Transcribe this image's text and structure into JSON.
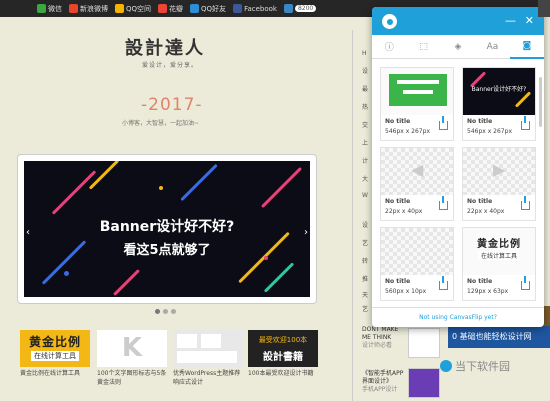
{
  "share_bar": {
    "items": [
      {
        "label": "微信",
        "color": "#3ca73f"
      },
      {
        "label": "新浪微博",
        "color": "#e8452b"
      },
      {
        "label": "QQ空间",
        "color": "#f5b400"
      },
      {
        "label": "花瓣",
        "color": "#e43"
      },
      {
        "label": "QQ好友",
        "color": "#2d8ed8"
      },
      {
        "label": "Facebook",
        "color": "#3b5998"
      }
    ],
    "count": "8200"
  },
  "site": {
    "logo": "設計達人",
    "tagline": "爱设计，爱分享。",
    "year": "-2017-",
    "year_sub": "小博客，大智慧，一起加油~"
  },
  "banner": {
    "line1": "Banner设计好不好?",
    "line2": "看这5点就够了",
    "prev": "‹",
    "next": "›"
  },
  "thumbs": [
    {
      "caption": "黄金比例在线计算工具",
      "t1": "黄金比例",
      "t2": "在线计算工具"
    },
    {
      "caption": "100个文字图形标志与5条黄金法则",
      "t1": "K"
    },
    {
      "caption": "优秀WordPress主题推荐 响应式设计"
    },
    {
      "caption": "100本最受欢迎设计书籍",
      "t1": "最受欢迎100本",
      "t2": "設計書籍"
    }
  ],
  "right_col": {
    "chars": [
      "H",
      "设",
      "最",
      "热",
      "交",
      "上",
      "计",
      "大",
      "W",
      "设",
      "艺",
      "转",
      "推",
      "天",
      "艺"
    ],
    "items": [
      {
        "title": "DONT MAKE ME THINK",
        "sub": "设计师必看"
      },
      {
        "title": "《智能手机APP界面设计》",
        "sub": "手机APP设计"
      }
    ],
    "ad_text": "0 基础也能轻松设计网",
    "watermark": "当下软件园"
  },
  "panel": {
    "tabs": [
      {
        "icon": "info-icon",
        "label": "ⓘ"
      },
      {
        "icon": "cursor-icon",
        "label": "⬚"
      },
      {
        "icon": "drop-icon",
        "label": "◈"
      },
      {
        "icon": "font-icon",
        "label": "Aa"
      },
      {
        "icon": "camera-icon",
        "label": "◙"
      }
    ],
    "cards": [
      {
        "title": "No title",
        "size": "546px x 267px",
        "kind": "green"
      },
      {
        "title": "No title",
        "size": "546px x 267px",
        "kind": "banner"
      },
      {
        "title": "No title",
        "size": "22px x 40px",
        "kind": "arrow-left"
      },
      {
        "title": "No title",
        "size": "22px x 40px",
        "kind": "arrow-right"
      },
      {
        "title": "No title",
        "size": "560px x 10px",
        "kind": "checker"
      },
      {
        "title": "No title",
        "size": "129px x 63px",
        "kind": "golden"
      }
    ],
    "footer": "Not using CanvasFlip yet?",
    "golden_t1": "黄金比例",
    "golden_t2": "在线计算工具",
    "banner_mini": "Banner设计好不好?"
  }
}
